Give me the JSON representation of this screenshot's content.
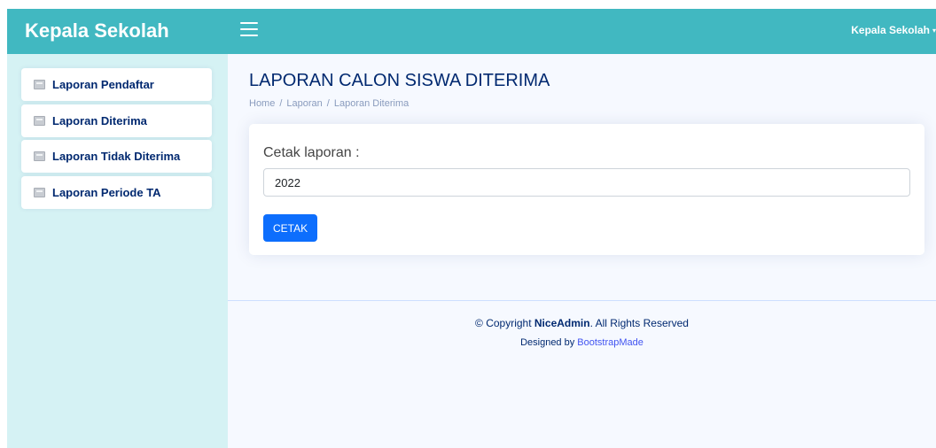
{
  "header": {
    "brand": "Kepala Sekolah",
    "menu_icon": "hamburger-menu-icon",
    "user_label": "Kepala Sekolah",
    "user_caret": "▾"
  },
  "sidebar": {
    "items": [
      {
        "label": "Laporan Pendaftar",
        "icon": "document-icon"
      },
      {
        "label": "Laporan Diterima",
        "icon": "document-icon"
      },
      {
        "label": "Laporan Tidak Diterima",
        "icon": "document-icon"
      },
      {
        "label": "Laporan Periode TA",
        "icon": "document-icon"
      }
    ]
  },
  "main": {
    "title": "LAPORAN CALON SISWA DITERIMA",
    "breadcrumb": [
      "Home",
      "Laporan",
      "Laporan Diterima"
    ],
    "card": {
      "label": "Cetak laporan :",
      "input_value": "2022",
      "button_label": "CETAK"
    }
  },
  "footer": {
    "copyright_prefix": "© Copyright ",
    "copyright_brand": "NiceAdmin",
    "copyright_suffix": ". All Rights Reserved",
    "designed_by": "Designed by ",
    "designer": "BootstrapMade"
  },
  "colors": {
    "header_bg": "#41b8c1",
    "sidebar_bg": "#d5f2f4",
    "primary_button": "#0d6efd",
    "text_navy": "#012970"
  }
}
